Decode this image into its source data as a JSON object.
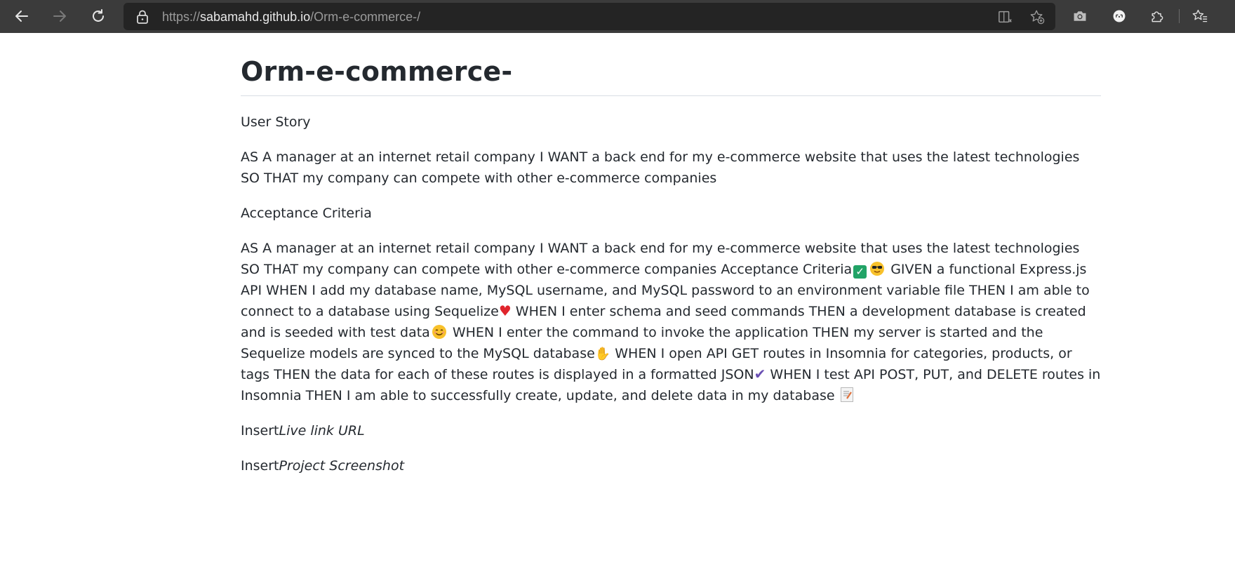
{
  "browser": {
    "url_prefix": "https://",
    "url_host": "sabamahd.github.io",
    "url_path": "/Orm-e-commerce-/",
    "icons": {
      "back": "back-arrow-icon",
      "forward": "forward-arrow-icon",
      "refresh": "refresh-icon",
      "lock": "lock-icon",
      "reader": "reader-mode-icon",
      "add_favorite": "add-favorite-icon",
      "screenshot": "camera-icon",
      "profile": "profile-icon",
      "extensions": "extensions-icon",
      "favorites": "favorites-icon"
    }
  },
  "page": {
    "title": "Orm-e-commerce-",
    "user_story_heading": "User Story",
    "user_story_text": "AS A manager at an internet retail company I WANT a back end for my e-commerce website that uses the latest technologies SO THAT my company can compete with other e-commerce companies",
    "acceptance_heading": "Acceptance Criteria",
    "acceptance": {
      "part1": "AS A manager at an internet retail company I WANT a back end for my e-commerce website that uses the latest technologies SO THAT my company can compete with other e-commerce companies Acceptance Criteria",
      "part2": " GIVEN a functional Express.js API WHEN I add my database name, MySQL username, and MySQL password to an environment variable file THEN I am able to connect to a database using Sequelize",
      "part3": " WHEN I enter schema and seed commands THEN a development database is created and is seeded with test data",
      "part4": " WHEN I enter the command to invoke the application THEN my server is started and the Sequelize models are synced to the MySQL database",
      "part5": " WHEN I open API GET routes in Insomnia for categories, products, or tags THEN the data for each of these routes is displayed in a formatted JSON",
      "part6": " WHEN I test API POST, PUT, and DELETE routes in Insomnia THEN I am able to successfully create, update, and delete data in my database "
    },
    "live_link_prefix": "Insert",
    "live_link_label": "Live link URL",
    "screenshot_prefix": "Insert",
    "screenshot_label": "Project Screenshot"
  }
}
